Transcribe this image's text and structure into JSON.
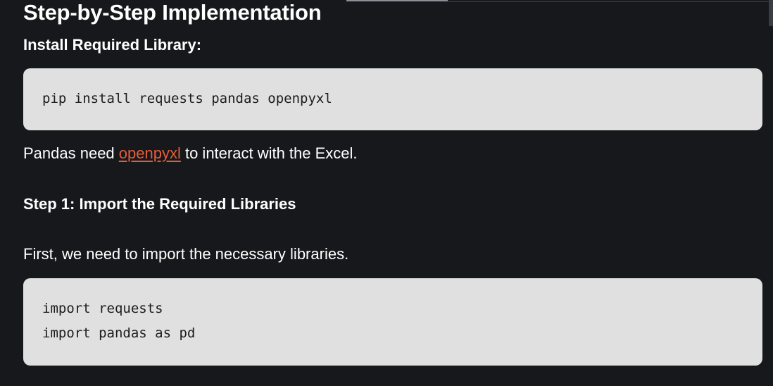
{
  "section": {
    "title": "Step-by-Step Implementation"
  },
  "install": {
    "heading": "Install Required Library:",
    "code_lines": [
      "pip install requests pandas openpyxl"
    ],
    "note_before": "Pandas need ",
    "note_link": "openpyxl",
    "note_after": " to interact with the Excel."
  },
  "step1": {
    "heading": "Step 1: Import the Required Libraries",
    "description": "First, we need to import the necessary libraries.",
    "code_lines": [
      "import requests",
      "import pandas as pd"
    ]
  },
  "colors": {
    "background": "#17181b",
    "code_background": "#e0e0e0",
    "link": "#e35d3a"
  }
}
